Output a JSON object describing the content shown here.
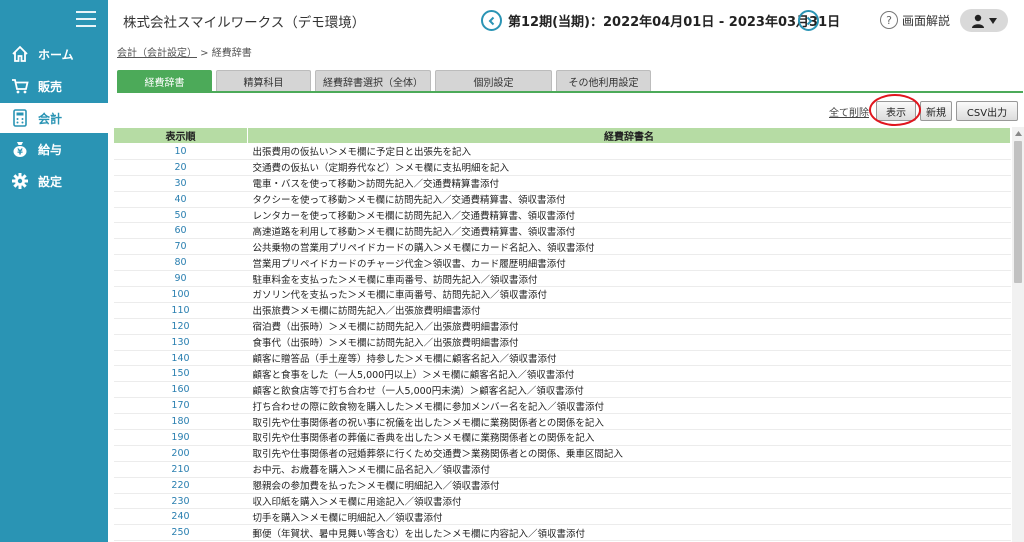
{
  "sidebar": {
    "items": [
      {
        "label": "ホーム",
        "icon": "home-icon"
      },
      {
        "label": "販売",
        "icon": "cart-icon"
      },
      {
        "label": "会計",
        "icon": "calculator-icon"
      },
      {
        "label": "給与",
        "icon": "money-bag-icon"
      },
      {
        "label": "設定",
        "icon": "gear-icon"
      }
    ],
    "active": "会計"
  },
  "header": {
    "company": "株式会社スマイルワークス（デモ環境）",
    "period": "第12期(当期)：2022年04月01日 - 2023年03月31日",
    "help_label": "画面解説"
  },
  "breadcrumb": {
    "parent": "会計（会計設定）",
    "separator": " > ",
    "current": "経費辞書"
  },
  "tabs": [
    {
      "label": "経費辞書",
      "active": true
    },
    {
      "label": "精算科目",
      "active": false
    },
    {
      "label": "経費辞書選択（全体）",
      "active": false
    },
    {
      "label": "個別設定",
      "active": false
    },
    {
      "label": "その他利用設定",
      "active": false
    }
  ],
  "toolbar": {
    "delete_all": "全て削除",
    "display": "表示",
    "new": "新規",
    "csv": "CSV出力"
  },
  "table": {
    "headers": [
      "表示順",
      "経費辞書名"
    ],
    "rows": [
      [
        "10",
        "出張費用の仮払い＞メモ欄に予定日と出張先を記入"
      ],
      [
        "20",
        "交通費の仮払い（定期券代など）＞メモ欄に支払明細を記入"
      ],
      [
        "30",
        "電車・バスを使って移動＞訪問先記入／交通費精算書添付"
      ],
      [
        "40",
        "タクシーを使って移動＞メモ欄に訪問先記入／交通費精算書、領収書添付"
      ],
      [
        "50",
        "レンタカーを使って移動＞メモ欄に訪問先記入／交通費精算書、領収書添付"
      ],
      [
        "60",
        "高速道路を利用して移動＞メモ欄に訪問先記入／交通費精算書、領収書添付"
      ],
      [
        "70",
        "公共乗物の営業用プリペイドカードの購入＞メモ欄にカード名記入、領収書添付"
      ],
      [
        "80",
        "営業用プリペイドカードのチャージ代金＞領収書、カード履歴明細書添付"
      ],
      [
        "90",
        "駐車料金を支払った＞メモ欄に車両番号、訪問先記入／領収書添付"
      ],
      [
        "100",
        "ガソリン代を支払った＞メモ欄に車両番号、訪問先記入／領収書添付"
      ],
      [
        "110",
        "出張旅費＞メモ欄に訪問先記入／出張旅費明細書添付"
      ],
      [
        "120",
        "宿泊費（出張時）＞メモ欄に訪問先記入／出張旅費明細書添付"
      ],
      [
        "130",
        "食事代（出張時）＞メモ欄に訪問先記入／出張旅費明細書添付"
      ],
      [
        "140",
        "顧客に贈答品（手土産等）持参した＞メモ欄に顧客名記入／領収書添付"
      ],
      [
        "150",
        "顧客と食事をした（一人5,000円以上）＞メモ欄に顧客名記入／領収書添付"
      ],
      [
        "160",
        "顧客と飲食店等で打ち合わせ（一人5,000円未満）＞顧客名記入／領収書添付"
      ],
      [
        "170",
        "打ち合わせの際に飲食物を購入した＞メモ欄に参加メンバー名を記入／領収書添付"
      ],
      [
        "180",
        "取引先や仕事関係者の祝い事に祝儀を出した＞メモ欄に業務関係者との関係を記入"
      ],
      [
        "190",
        "取引先や仕事関係者の葬儀に香典を出した＞メモ欄に業務関係者との関係を記入"
      ],
      [
        "200",
        "取引先や仕事関係者の冠婚葬祭に行くため交通費＞業務関係者との関係、乗車区間記入"
      ],
      [
        "210",
        "お中元、お歳暮を購入＞メモ欄に品名記入／領収書添付"
      ],
      [
        "220",
        "懇親会の参加費を払った＞メモ欄に明細記入／領収書添付"
      ],
      [
        "230",
        "収入印紙を購入＞メモ欄に用途記入／領収書添付"
      ],
      [
        "240",
        "切手を購入＞メモ欄に明細記入／領収書添付"
      ],
      [
        "250",
        "郵便（年賀状、暑中見舞い等含む）を出した＞メモ欄に内容記入／領収書添付"
      ]
    ]
  },
  "colors": {
    "sidebar": "#2a94b4",
    "active_tab": "#4caa59",
    "table_header": "#b6dca4",
    "link": "#2a7fb0",
    "highlight_ring": "#e0161e"
  }
}
